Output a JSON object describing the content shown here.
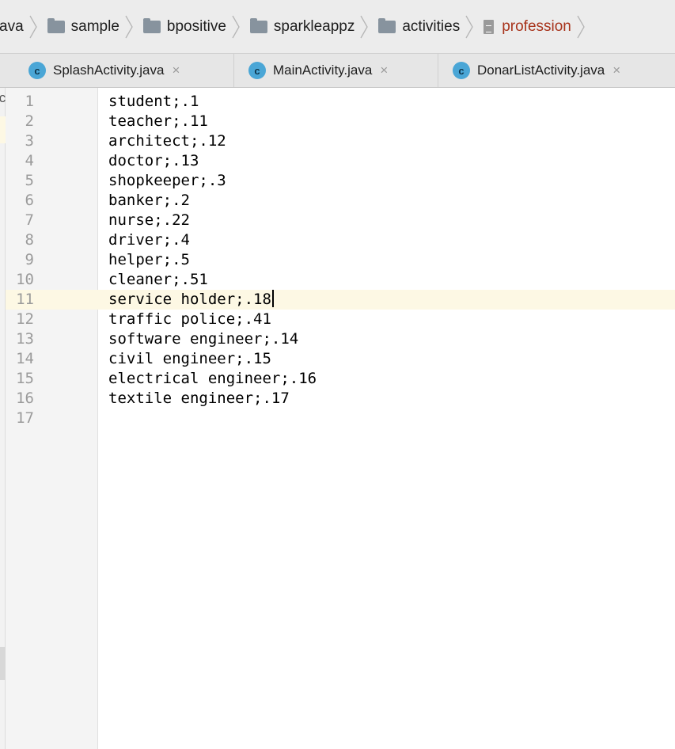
{
  "breadcrumb": {
    "items": [
      {
        "label": "ava",
        "icon": "none"
      },
      {
        "label": "sample",
        "icon": "folder-icon"
      },
      {
        "label": "bpositive",
        "icon": "folder-icon"
      },
      {
        "label": "sparkleappz",
        "icon": "folder-icon"
      },
      {
        "label": "activities",
        "icon": "folder-icon"
      },
      {
        "label": "profession",
        "icon": "text-file-icon",
        "active": true
      }
    ]
  },
  "tabs": [
    {
      "label": "SplashActivity.java",
      "icon_letter": "c"
    },
    {
      "label": "MainActivity.java",
      "icon_letter": "c"
    },
    {
      "label": "DonarListActivity.java",
      "icon_letter": "c"
    }
  ],
  "tab_close_glyph": "×",
  "left_strip_text": "ic",
  "editor": {
    "current_line": 11,
    "lines": [
      {
        "num": "1",
        "text": "student;.1"
      },
      {
        "num": "2",
        "text": "teacher;.11"
      },
      {
        "num": "3",
        "text": "architect;.12"
      },
      {
        "num": "4",
        "text": "doctor;.13"
      },
      {
        "num": "5",
        "text": "shopkeeper;.3"
      },
      {
        "num": "6",
        "text": "banker;.2"
      },
      {
        "num": "7",
        "text": "nurse;.22"
      },
      {
        "num": "8",
        "text": "driver;.4"
      },
      {
        "num": "9",
        "text": "helper;.5"
      },
      {
        "num": "10",
        "text": "cleaner;.51"
      },
      {
        "num": "11",
        "text": "service holder;.18"
      },
      {
        "num": "12",
        "text": "traffic police;.41"
      },
      {
        "num": "13",
        "text": "software engineer;.14"
      },
      {
        "num": "14",
        "text": "civil engineer;.15"
      },
      {
        "num": "15",
        "text": "electrical engineer;.16"
      },
      {
        "num": "16",
        "text": "textile engineer;.17"
      },
      {
        "num": "17",
        "text": ""
      }
    ]
  },
  "colors": {
    "active_crumb": "#a8341c",
    "current_line_bg": "#fdf8e4",
    "class_icon": "#4aa6d6"
  }
}
